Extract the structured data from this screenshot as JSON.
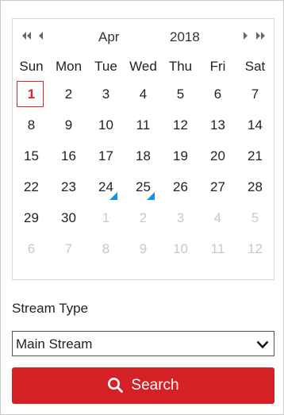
{
  "calendar": {
    "month": "Apr",
    "year": "2018",
    "weekdays": [
      "Sun",
      "Mon",
      "Tue",
      "Wed",
      "Thu",
      "Fri",
      "Sat"
    ],
    "weeks": [
      [
        "1",
        "2",
        "3",
        "4",
        "5",
        "6",
        "7"
      ],
      [
        "8",
        "9",
        "10",
        "11",
        "12",
        "13",
        "14"
      ],
      [
        "15",
        "16",
        "17",
        "18",
        "19",
        "20",
        "21"
      ],
      [
        "22",
        "23",
        "24",
        "25",
        "26",
        "27",
        "28"
      ],
      [
        "29",
        "30",
        "1",
        "2",
        "3",
        "4",
        "5"
      ],
      [
        "6",
        "7",
        "8",
        "9",
        "10",
        "11",
        "12"
      ]
    ],
    "selected_day": "1",
    "days_with_recordings": [
      "24",
      "25"
    ],
    "icons": {
      "prev_year": "double-chevron-left-icon",
      "prev_month": "chevron-left-icon",
      "next_month": "chevron-right-icon",
      "next_year": "double-chevron-right-icon"
    }
  },
  "stream": {
    "label": "Stream Type",
    "selected": "Main Stream",
    "dropdown_icon": "chevron-down-icon"
  },
  "search": {
    "label": "Search",
    "icon": "search-icon"
  },
  "colors": {
    "accent_red": "#d42126",
    "recording_marker": "#1b8fe3",
    "muted_day": "#c8c8c8"
  }
}
